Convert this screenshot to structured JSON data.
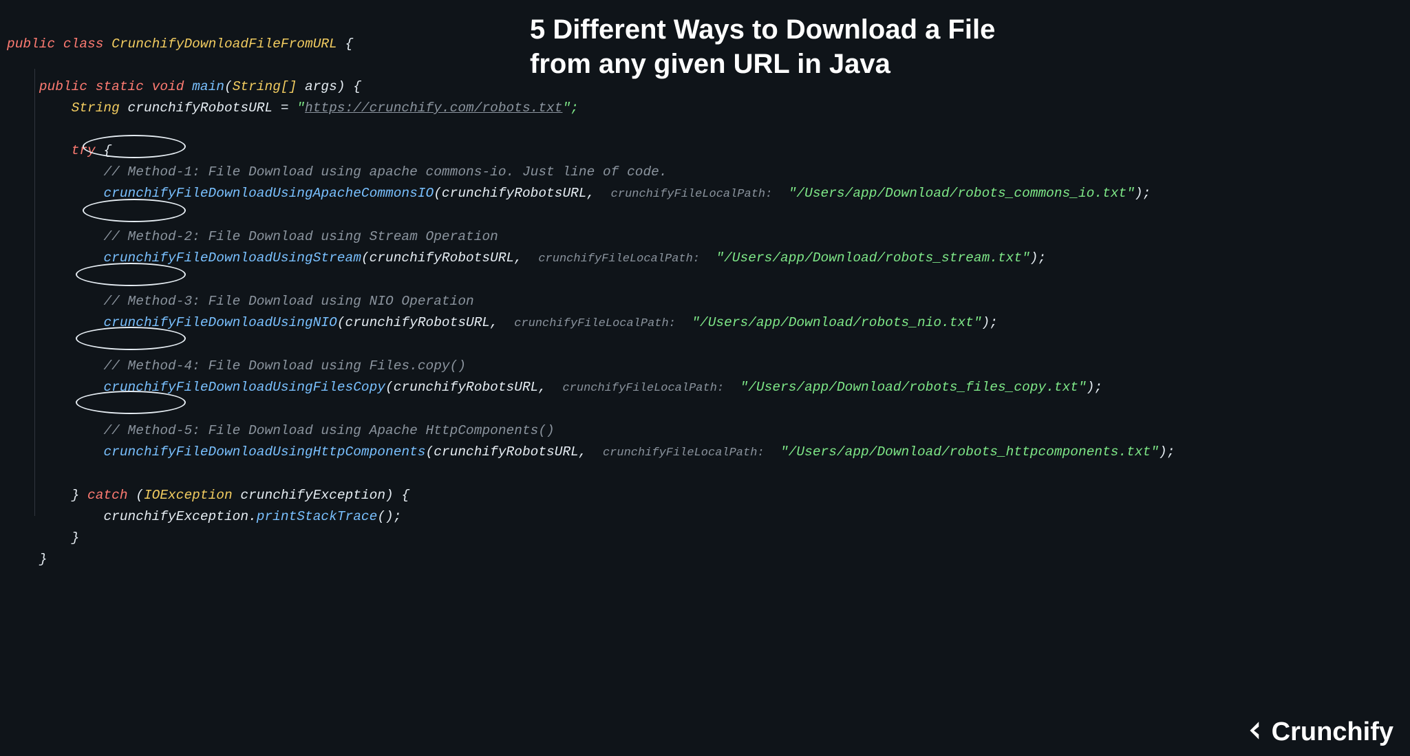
{
  "title": "5 Different Ways to Download a File from any given URL in Java",
  "logoText": "Crunchify",
  "code": {
    "classDecl": {
      "kw1": "public",
      "kw2": "class",
      "name": "CrunchifyDownloadFileFromURL",
      "brace": "{"
    },
    "mainDecl": {
      "kw1": "public",
      "kw2": "static",
      "kw3": "void",
      "fn": "main",
      "argsType": "String[]",
      "argsName": "args",
      "brace": "{"
    },
    "varLine": {
      "type": "String",
      "name": "crunchifyRobotsURL",
      "eq": "=",
      "q": "\"",
      "url": "https://crunchify.com/robots.txt",
      "end": "\";"
    },
    "tryKw": "try",
    "hintLabel": "crunchifyFileLocalPath:",
    "arg1": "crunchifyRobotsURL",
    "methods": [
      {
        "comment": "// Method-1:",
        "commentTail": " File Download using apache commons-io. Just line of code.",
        "call": "crunchifyFileDownloadUsingApacheCommonsIO",
        "path": "\"/Users/app/Download/robots_commons_io.txt\""
      },
      {
        "comment": "// Method-2:",
        "commentTail": " File Download using Stream Operation",
        "call": "crunchifyFileDownloadUsingStream",
        "path": "\"/Users/app/Download/robots_stream.txt\""
      },
      {
        "comment": "// Method-3:",
        "commentTail": " File Download using NIO Operation",
        "call": "crunchifyFileDownloadUsingNIO",
        "path": "\"/Users/app/Download/robots_nio.txt\""
      },
      {
        "comment": "// Method-4:",
        "commentTail": " File Download using Files.copy()",
        "call": "crunchifyFileDownloadUsingFilesCopy",
        "path": "\"/Users/app/Download/robots_files_copy.txt\""
      },
      {
        "comment": "// Method-5:",
        "commentTail": " File Download using Apache HttpComponents()",
        "call": "crunchifyFileDownloadUsingHttpComponents",
        "path": "\"/Users/app/Download/robots_httpcomponents.txt\""
      }
    ],
    "catch": {
      "kw": "catch",
      "exType": "IOException",
      "exName": "crunchifyException",
      "brace": "{"
    },
    "catchBody": {
      "obj": "crunchifyException",
      "dot": ".",
      "fn": "printStackTrace",
      "tail": "();"
    },
    "closeBrace": "}"
  }
}
